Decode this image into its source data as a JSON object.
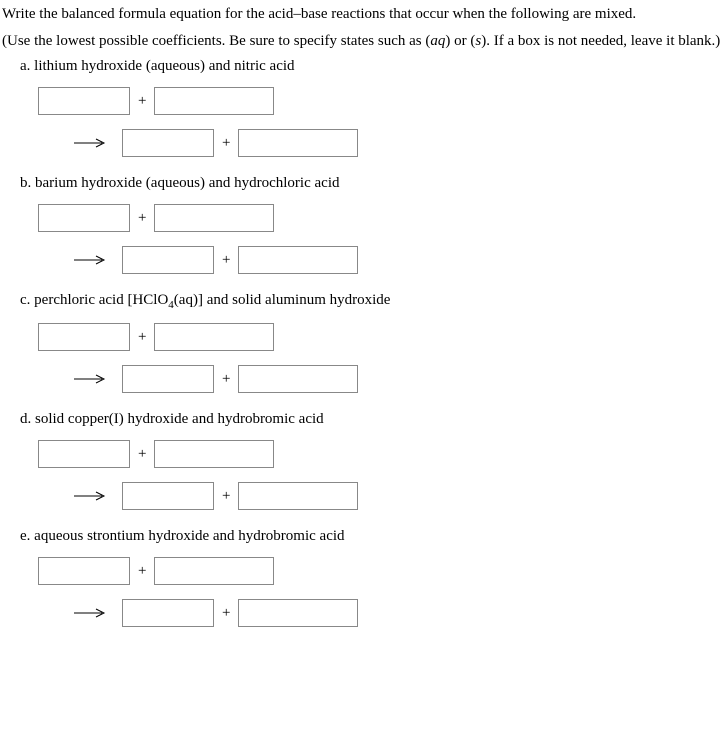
{
  "instruction_line1": "Write the balanced formula equation for the acid–base reactions that occur when the following are mixed.",
  "instruction_line2_pre": "(Use the lowest possible coefficients. Be sure to specify states such as (",
  "instruction_line2_aq": "aq",
  "instruction_line2_mid": ") or (",
  "instruction_line2_s": "s",
  "instruction_line2_post": "). If a box is not needed, leave it blank.)",
  "questions": {
    "a": {
      "letter": "a.",
      "text": "lithium hydroxide (aqueous) and nitric acid"
    },
    "b": {
      "letter": "b.",
      "text": "barium hydroxide (aqueous) and hydrochloric acid"
    },
    "c": {
      "letter": "c.",
      "prefix": "perchloric acid ",
      "formula_open": "[",
      "formula_h": "HClO",
      "formula_sub": "4",
      "formula_state": "(aq)",
      "formula_close": "]",
      "suffix": " and solid aluminum hydroxide"
    },
    "d": {
      "letter": "d.",
      "text": "solid copper(I) hydroxide and hydrobromic acid"
    },
    "e": {
      "letter": "e.",
      "text": "aqueous strontium hydroxide and hydrobromic acid"
    }
  },
  "plus_sign": "+"
}
